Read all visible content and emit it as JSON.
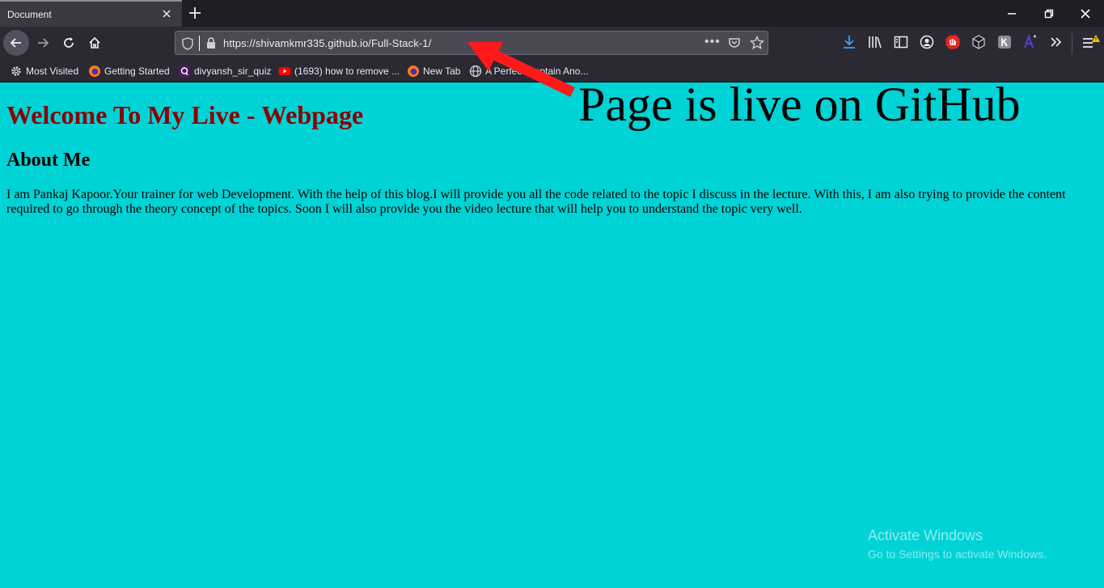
{
  "browser": {
    "tab": {
      "title": "Document"
    },
    "url": "https://shivamkmr335.github.io/Full-Stack-1/",
    "url_more": "•••"
  },
  "bookmarks": [
    {
      "label": "Most Visited",
      "icon": "gear-icon"
    },
    {
      "label": "Getting Started",
      "icon": "firefox-icon"
    },
    {
      "label": "divyansh_sir_quiz",
      "icon": "quiz-app-icon"
    },
    {
      "label": "(1693) how to remove ...",
      "icon": "youtube-icon"
    },
    {
      "label": "New Tab",
      "icon": "firefox-icon"
    },
    {
      "label": "A Perfect Captain Ano...",
      "icon": "globe-icon"
    }
  ],
  "page": {
    "heading": "Welcome To My Live - Webpage",
    "subheading": "About Me",
    "paragraph": "I am Pankaj Kapoor.Your trainer for web Development. With the help of this blog.I will provide you all the code related to the topic I discuss in the lecture. With this, I am also trying to provide the content required to go through the theory concept of the topics. Soon I will also provide you the video lecture that will help you to understand the topic very well."
  },
  "annotation": {
    "text": "Page is live on GitHub",
    "arrow_color": "#ff1a1a"
  },
  "watermark": {
    "line1": "Activate Windows",
    "line2": "Go to Settings to activate Windows."
  },
  "colors": {
    "page_background": "#00d3d6",
    "heading": "#8b0000",
    "chrome": "#2b2a33"
  }
}
